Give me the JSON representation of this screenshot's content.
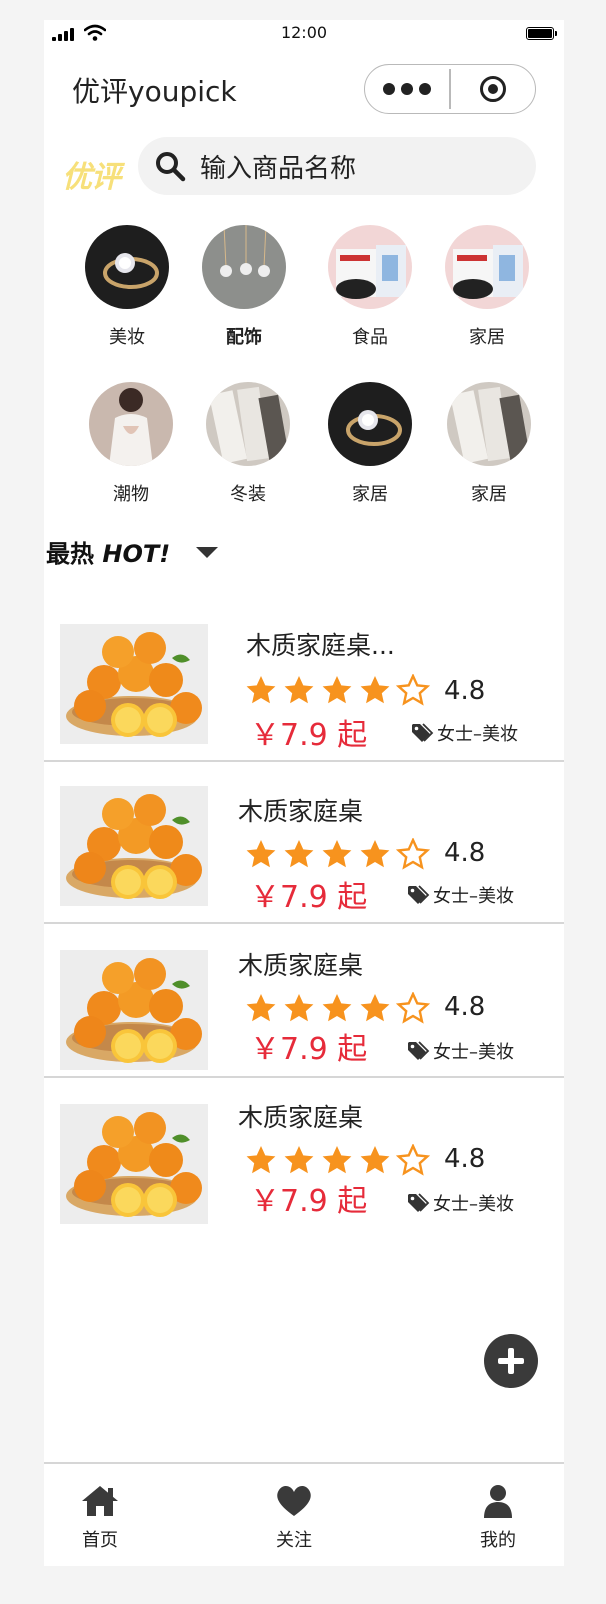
{
  "status_bar": {
    "time": "12:00"
  },
  "nav": {
    "title": "优评youpick"
  },
  "logo": "优评",
  "search": {
    "placeholder": "输入商品名称"
  },
  "categories": [
    {
      "label": "美妆",
      "image": "ring"
    },
    {
      "label": "配饰",
      "image": "earrings"
    },
    {
      "label": "食品",
      "image": "food-boxes"
    },
    {
      "label": "家居",
      "image": "food-boxes"
    },
    {
      "label": "潮物",
      "image": "fashion-model"
    },
    {
      "label": "冬装",
      "image": "winter-clothes"
    },
    {
      "label": "家居",
      "image": "ring"
    },
    {
      "label": "家居",
      "image": "winter-clothes"
    }
  ],
  "section": {
    "title_cn": "最热",
    "title_en": "HOT!"
  },
  "products": [
    {
      "name": "木质家庭桌...",
      "stars": 4,
      "rating": "4.8",
      "price": "￥7.9 起",
      "tag": "女士–美妆"
    },
    {
      "name": "木质家庭桌",
      "stars": 4,
      "rating": "4.8",
      "price": "￥7.9 起",
      "tag": "女士–美妆"
    },
    {
      "name": "木质家庭桌",
      "stars": 4,
      "rating": "4.8",
      "price": "￥7.9 起",
      "tag": "女士–美妆"
    },
    {
      "name": "木质家庭桌",
      "stars": 4,
      "rating": "4.8",
      "price": "￥7.9 起",
      "tag": "女士–美妆"
    }
  ],
  "tabs": [
    {
      "label": "首页",
      "icon": "home-icon"
    },
    {
      "label": "关注",
      "icon": "heart-icon"
    },
    {
      "label": "我的",
      "icon": "user-icon"
    }
  ],
  "colors": {
    "price": "#e62b3a",
    "star": "#f7931e",
    "logo": "#f7e07a"
  }
}
